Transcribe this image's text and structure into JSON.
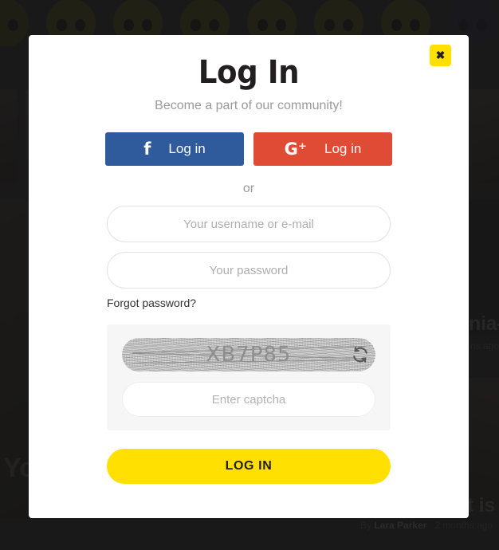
{
  "modal": {
    "title": "Log In",
    "subtitle": "Become a part of our community!",
    "close_label": "✖",
    "close_icon": "close-icon",
    "social": [
      {
        "provider": "facebook",
        "icon": "facebook-icon",
        "glyph": "f",
        "label": "Log in",
        "color": "#2f5b9c"
      },
      {
        "provider": "google",
        "icon": "google-plus-icon",
        "glyph": "G⁺",
        "label": "Log in",
        "color": "#e04b36"
      }
    ],
    "divider_label": "or",
    "fields": {
      "username_placeholder": "Your username or e-mail",
      "username_value": "",
      "password_placeholder": "Your password",
      "password_value": ""
    },
    "forgot_password_label": "Forgot password?",
    "captcha": {
      "code": "XB7P85",
      "refresh_icon": "refresh-icon",
      "input_placeholder": "Enter captcha",
      "input_value": ""
    },
    "submit_label": "LOG IN",
    "accent_color": "#ffe000"
  },
  "background": {
    "emoji_row": [
      {
        "name": "emoji-face-1",
        "color": "#5f5a10"
      },
      {
        "name": "emoji-face-2",
        "color": "#6a6410"
      },
      {
        "name": "emoji-face-3",
        "color": "#6a6410"
      },
      {
        "name": "emoji-face-4",
        "color": "#6a6410"
      },
      {
        "name": "emoji-face-5",
        "color": "#6a6410"
      },
      {
        "name": "emoji-face-6",
        "color": "#6a6410"
      },
      {
        "name": "emoji-face-7",
        "color": "#6a6410"
      },
      {
        "name": "emoji-face-8",
        "color": "#2d2c46"
      },
      {
        "name": "emoji-face-9",
        "color": "#2d2c46"
      },
      {
        "name": "emoji-face-10",
        "color": "#4a2226"
      }
    ],
    "article_right": {
      "title": "nia-",
      "meta": "ns ago"
    },
    "article_bottom": {
      "title": "t is r",
      "byline_prefix": "By",
      "author": "Lara Parker",
      "timestamp": "2 months ago"
    },
    "hero_title": "You"
  }
}
